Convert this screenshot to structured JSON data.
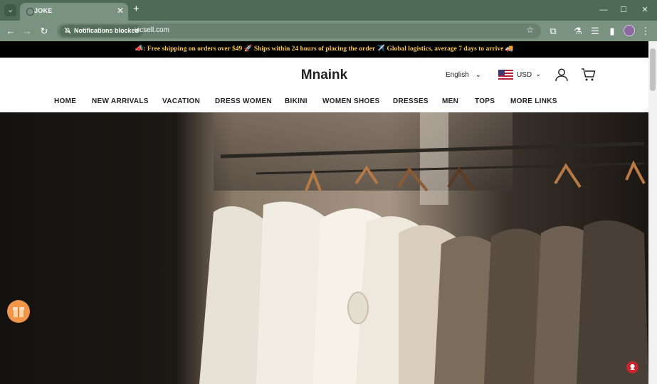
{
  "browser": {
    "tab_title": "JOKE",
    "notifications_chip": "Notifications blocked",
    "url": "vicsell.com"
  },
  "store": {
    "announcement": "📣: Free shipping on orders over $49 🚀 Ships within 24 hours of placing the order ✈️ Global logistics, average 7 days to arrive 🚚",
    "logo": "Mnaink",
    "language": "English",
    "currency": "USD",
    "nav": [
      "HOME",
      "NEW ARRIVALS",
      "VACATION",
      "DRESS WOMEN",
      "BIKINI",
      "WOMEN SHOES",
      "DRESSES",
      "MEN",
      "TOPS",
      "MORE LINKS"
    ]
  },
  "icons": {
    "tab_menu": "chevron-down-icon",
    "back": "arrow-left-icon",
    "forward": "arrow-right-icon",
    "reload": "reload-icon",
    "bell_off": "bell-off-icon",
    "bookmark": "star-icon",
    "extensions": "puzzle-icon",
    "labs": "flask-icon",
    "reading_list": "list-icon",
    "side_panel": "side-panel-icon",
    "menu": "kebab-menu-icon",
    "account": "user-icon",
    "cart": "cart-icon",
    "gift": "gift-icon",
    "chat": "chat-icon"
  },
  "colors": {
    "browser_frame": "#4e6b55",
    "announcement_bg": "#000000",
    "announcement_text": "#f5c451",
    "gift_button": "#f0954a",
    "chat_button": "#c9252e"
  }
}
